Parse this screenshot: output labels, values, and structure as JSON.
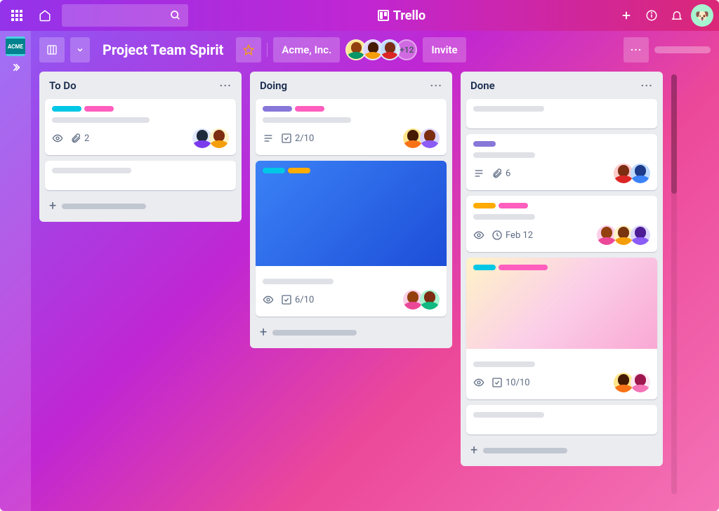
{
  "app_name": "Trello",
  "workspace_badge": "ACME",
  "board": {
    "title": "Project Team Spirit",
    "visibility": "Acme, Inc.",
    "invite_label": "Invite",
    "extra_members": "+12"
  },
  "colors": {
    "cyan": "#00C7E6",
    "pink": "#FF5EBE",
    "purple": "#8777D9",
    "yellow": "#FFAB00",
    "blue": "#0065FF"
  },
  "lists": [
    {
      "title": "To Do",
      "cards": [
        {
          "labels": [
            "cyan",
            "pink"
          ],
          "badges": {
            "watch": true,
            "attachments": "2"
          },
          "members": 2
        },
        {
          "empty": true
        }
      ]
    },
    {
      "title": "Doing",
      "cards": [
        {
          "labels": [
            "purple",
            "pink"
          ],
          "badges": {
            "description": true,
            "checklist": "2/10"
          },
          "members": 2
        },
        {
          "cover": "blue",
          "cover_labels": [
            "cyan",
            "yellow"
          ],
          "badges": {
            "watch": true,
            "checklist": "6/10"
          },
          "members": 2
        }
      ]
    },
    {
      "title": "Done",
      "cards": [
        {
          "empty": true
        },
        {
          "labels": [
            "purple"
          ],
          "badges": {
            "description": true,
            "attachments": "6"
          },
          "members": 2
        },
        {
          "labels": [
            "yellow",
            "pink"
          ],
          "badges": {
            "watch": true,
            "due": "Feb 12"
          },
          "members": 3
        },
        {
          "cover": "pink",
          "cover_labels": [
            "cyan",
            "pink"
          ],
          "badges": {
            "watch": true,
            "checklist": "10/10"
          },
          "members": 2
        },
        {
          "empty": true
        }
      ]
    }
  ]
}
